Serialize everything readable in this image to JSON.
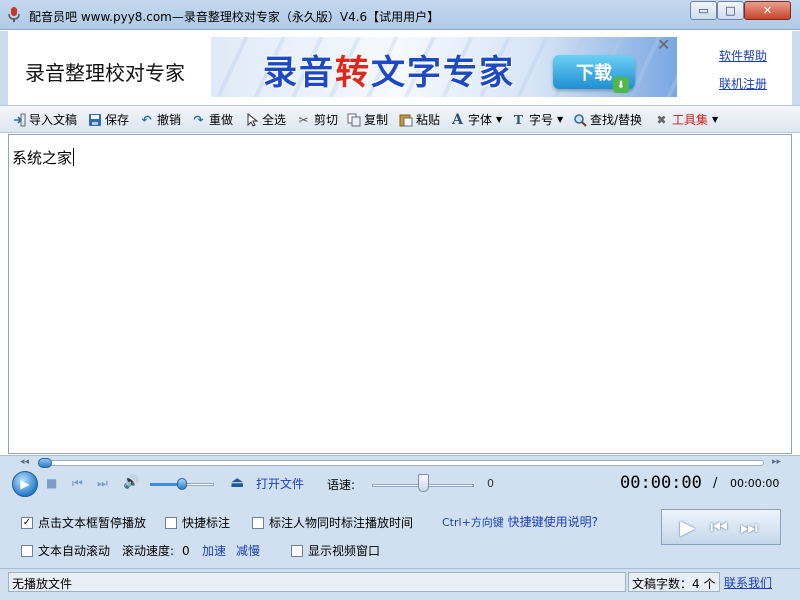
{
  "window": {
    "title": "配音员吧 www.pyy8.com—录音整理校对专家（永久版）V4.6【试用用户】",
    "min_glyph": "▭",
    "max_glyph": "□",
    "close_glyph": "✕"
  },
  "header": {
    "app_name": "录音整理校对专家",
    "banner_text_1": "录音",
    "banner_text_red": "转",
    "banner_text_2": "文字专家",
    "banner_download": "下载",
    "banner_close": "✕",
    "help_link": "软件帮助",
    "register_link": "联机注册"
  },
  "toolbar": {
    "import": "导入文稿",
    "save": "保存",
    "undo": "撤销",
    "redo": "重做",
    "select_all": "全选",
    "cut": "剪切",
    "copy": "复制",
    "paste": "粘贴",
    "font": "字体",
    "font_size": "字号",
    "find_replace": "查找/替换",
    "tools": "工具集"
  },
  "editor": {
    "content": "系统之家"
  },
  "player": {
    "open_file": "打开文件",
    "speed_label": "语速:",
    "speed_value": "0",
    "time_current": "00:00:00",
    "time_separator": "/",
    "time_total": "00:00:00",
    "opt_click_pause": "点击文本框暂停播放",
    "opt_click_pause_checked": true,
    "opt_quick_mark": "快捷标注",
    "opt_quick_mark_checked": false,
    "opt_mark_person_time": "标注人物同时标注播放时间",
    "opt_mark_person_time_checked": false,
    "opt_auto_scroll": "文本自动滚动",
    "opt_auto_scroll_checked": false,
    "scroll_speed_label": "滚动速度:",
    "scroll_speed_value": "0",
    "speed_up": "加速",
    "slow_down": "减慢",
    "opt_show_video": "显示视频窗口",
    "opt_show_video_checked": false,
    "hint_shortcut": "Ctrl+方向键",
    "hint_help": "快捷键使用说明?"
  },
  "status": {
    "file_state": "无播放文件",
    "word_count": "文稿字数：4 个",
    "contact": "联系我们"
  }
}
